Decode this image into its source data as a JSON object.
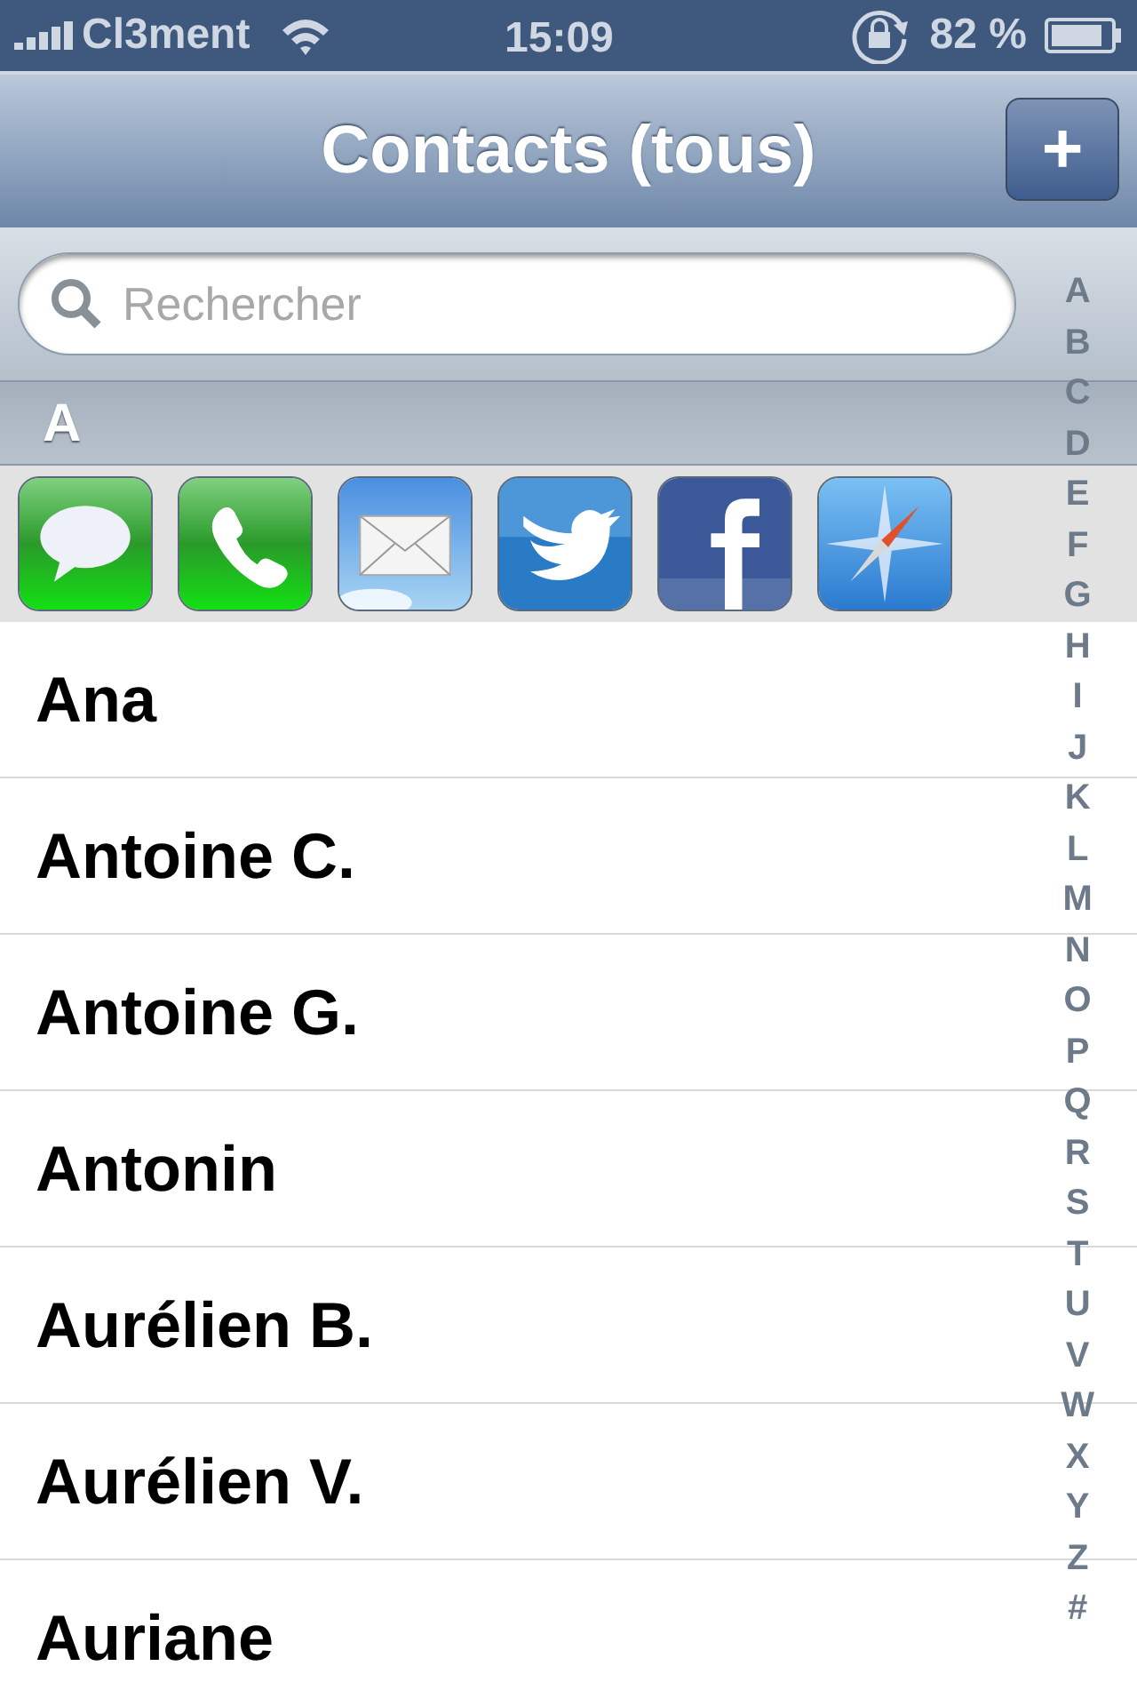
{
  "status_bar": {
    "carrier": "Cl3ment",
    "time": "15:09",
    "battery": "82 %"
  },
  "nav_bar": {
    "title": "Contacts (tous)",
    "add_button": "+"
  },
  "search": {
    "placeholder": "Rechercher"
  },
  "section": {
    "header": "A"
  },
  "shortcuts": [
    {
      "kind": "messages"
    },
    {
      "kind": "phone"
    },
    {
      "kind": "mail"
    },
    {
      "kind": "bird"
    },
    {
      "kind": "facebook"
    },
    {
      "kind": "compass"
    }
  ],
  "contacts": [
    "Ana",
    "Antoine C.",
    "Antoine G.",
    "Antonin",
    "Aurélien B.",
    "Aurélien V.",
    "Auriane"
  ],
  "index": [
    "A",
    "B",
    "C",
    "D",
    "E",
    "F",
    "G",
    "H",
    "I",
    "J",
    "K",
    "L",
    "M",
    "N",
    "O",
    "P",
    "Q",
    "R",
    "S",
    "T",
    "U",
    "V",
    "W",
    "X",
    "Y",
    "Z",
    "#"
  ]
}
